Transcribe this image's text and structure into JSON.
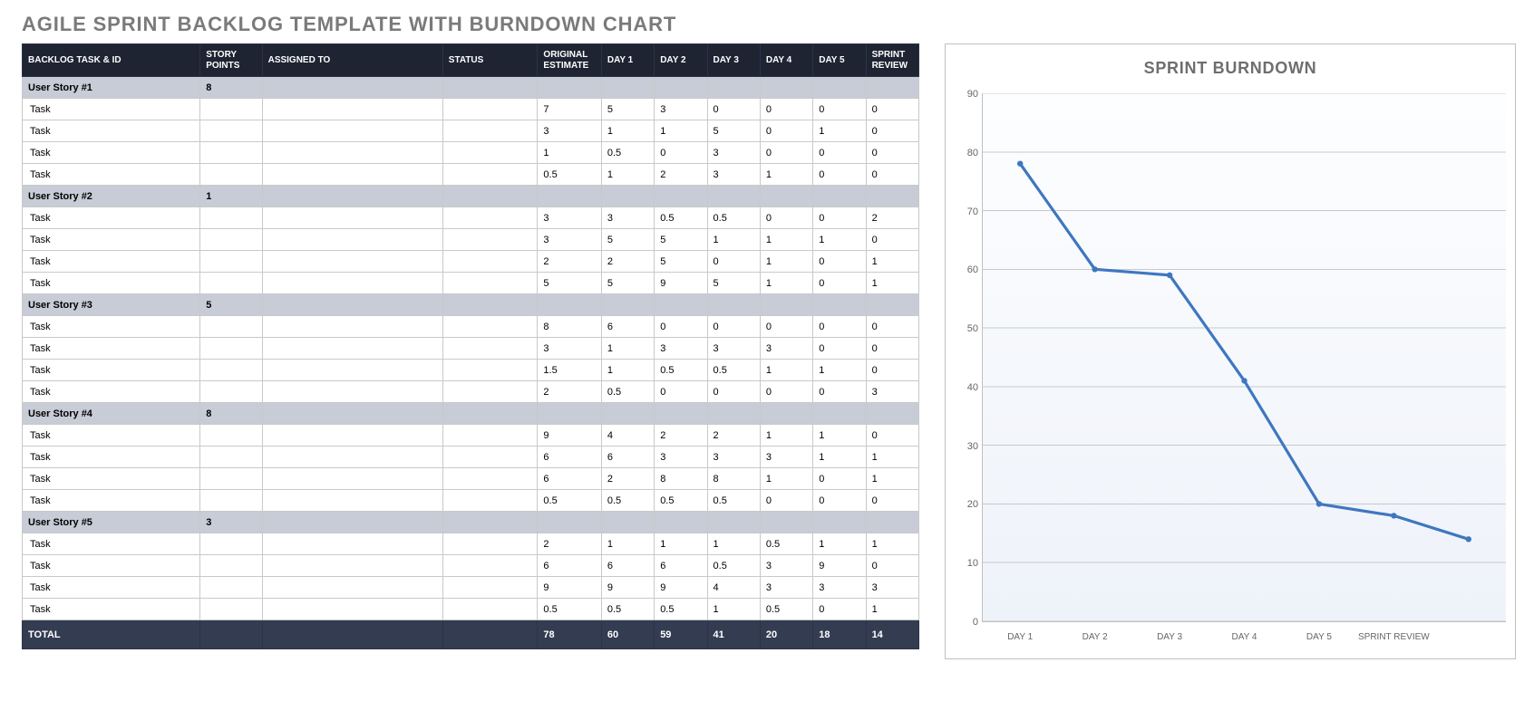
{
  "title": "AGILE SPRINT BACKLOG TEMPLATE WITH BURNDOWN CHART",
  "columns": [
    "BACKLOG TASK & ID",
    "STORY POINTS",
    "ASSIGNED TO",
    "STATUS",
    "ORIGINAL ESTIMATE",
    "DAY 1",
    "DAY 2",
    "DAY 3",
    "DAY 4",
    "DAY 5",
    "SPRINT REVIEW"
  ],
  "rows": [
    {
      "type": "story",
      "task": "User Story #1",
      "sp": "8",
      "assigned": "",
      "status": "",
      "vals": [
        "",
        "",
        "",
        "",
        "",
        "",
        ""
      ]
    },
    {
      "type": "task",
      "task": "Task",
      "sp": "",
      "assigned": "",
      "status": "",
      "vals": [
        "7",
        "5",
        "3",
        "0",
        "0",
        "0",
        "0"
      ]
    },
    {
      "type": "task",
      "task": "Task",
      "sp": "",
      "assigned": "",
      "status": "",
      "vals": [
        "3",
        "1",
        "1",
        "5",
        "0",
        "1",
        "0"
      ]
    },
    {
      "type": "task",
      "task": "Task",
      "sp": "",
      "assigned": "",
      "status": "",
      "vals": [
        "1",
        "0.5",
        "0",
        "3",
        "0",
        "0",
        "0"
      ]
    },
    {
      "type": "task",
      "task": "Task",
      "sp": "",
      "assigned": "",
      "status": "",
      "vals": [
        "0.5",
        "1",
        "2",
        "3",
        "1",
        "0",
        "0"
      ]
    },
    {
      "type": "story",
      "task": "User Story #2",
      "sp": "1",
      "assigned": "",
      "status": "",
      "vals": [
        "",
        "",
        "",
        "",
        "",
        "",
        ""
      ]
    },
    {
      "type": "task",
      "task": "Task",
      "sp": "",
      "assigned": "",
      "status": "",
      "vals": [
        "3",
        "3",
        "0.5",
        "0.5",
        "0",
        "0",
        "2"
      ]
    },
    {
      "type": "task",
      "task": "Task",
      "sp": "",
      "assigned": "",
      "status": "",
      "vals": [
        "3",
        "5",
        "5",
        "1",
        "1",
        "1",
        "0"
      ]
    },
    {
      "type": "task",
      "task": "Task",
      "sp": "",
      "assigned": "",
      "status": "",
      "vals": [
        "2",
        "2",
        "5",
        "0",
        "1",
        "0",
        "1"
      ]
    },
    {
      "type": "task",
      "task": "Task",
      "sp": "",
      "assigned": "",
      "status": "",
      "vals": [
        "5",
        "5",
        "9",
        "5",
        "1",
        "0",
        "1"
      ]
    },
    {
      "type": "story",
      "task": "User Story #3",
      "sp": "5",
      "assigned": "",
      "status": "",
      "vals": [
        "",
        "",
        "",
        "",
        "",
        "",
        ""
      ]
    },
    {
      "type": "task",
      "task": "Task",
      "sp": "",
      "assigned": "",
      "status": "",
      "vals": [
        "8",
        "6",
        "0",
        "0",
        "0",
        "0",
        "0"
      ]
    },
    {
      "type": "task",
      "task": "Task",
      "sp": "",
      "assigned": "",
      "status": "",
      "vals": [
        "3",
        "1",
        "3",
        "3",
        "3",
        "0",
        "0"
      ]
    },
    {
      "type": "task",
      "task": "Task",
      "sp": "",
      "assigned": "",
      "status": "",
      "vals": [
        "1.5",
        "1",
        "0.5",
        "0.5",
        "1",
        "1",
        "0"
      ]
    },
    {
      "type": "task",
      "task": "Task",
      "sp": "",
      "assigned": "",
      "status": "",
      "vals": [
        "2",
        "0.5",
        "0",
        "0",
        "0",
        "0",
        "3"
      ]
    },
    {
      "type": "story",
      "task": "User Story #4",
      "sp": "8",
      "assigned": "",
      "status": "",
      "vals": [
        "",
        "",
        "",
        "",
        "",
        "",
        ""
      ]
    },
    {
      "type": "task",
      "task": "Task",
      "sp": "",
      "assigned": "",
      "status": "",
      "vals": [
        "9",
        "4",
        "2",
        "2",
        "1",
        "1",
        "0"
      ]
    },
    {
      "type": "task",
      "task": "Task",
      "sp": "",
      "assigned": "",
      "status": "",
      "vals": [
        "6",
        "6",
        "3",
        "3",
        "3",
        "1",
        "1"
      ]
    },
    {
      "type": "task",
      "task": "Task",
      "sp": "",
      "assigned": "",
      "status": "",
      "vals": [
        "6",
        "2",
        "8",
        "8",
        "1",
        "0",
        "1"
      ]
    },
    {
      "type": "task",
      "task": "Task",
      "sp": "",
      "assigned": "",
      "status": "",
      "vals": [
        "0.5",
        "0.5",
        "0.5",
        "0.5",
        "0",
        "0",
        "0"
      ]
    },
    {
      "type": "story",
      "task": "User Story #5",
      "sp": "3",
      "assigned": "",
      "status": "",
      "vals": [
        "",
        "",
        "",
        "",
        "",
        "",
        ""
      ]
    },
    {
      "type": "task",
      "task": "Task",
      "sp": "",
      "assigned": "",
      "status": "",
      "vals": [
        "2",
        "1",
        "1",
        "1",
        "0.5",
        "1",
        "1"
      ]
    },
    {
      "type": "task",
      "task": "Task",
      "sp": "",
      "assigned": "",
      "status": "",
      "vals": [
        "6",
        "6",
        "6",
        "0.5",
        "3",
        "9",
        "0"
      ]
    },
    {
      "type": "task",
      "task": "Task",
      "sp": "",
      "assigned": "",
      "status": "",
      "vals": [
        "9",
        "9",
        "9",
        "4",
        "3",
        "3",
        "3"
      ]
    },
    {
      "type": "task",
      "task": "Task",
      "sp": "",
      "assigned": "",
      "status": "",
      "vals": [
        "0.5",
        "0.5",
        "0.5",
        "1",
        "0.5",
        "0",
        "1"
      ]
    }
  ],
  "totals": {
    "label": "TOTAL",
    "vals": [
      "78",
      "60",
      "59",
      "41",
      "20",
      "18",
      "14"
    ]
  },
  "chart_data": {
    "type": "line",
    "title": "SPRINT BURNDOWN",
    "categories": [
      "DAY 1",
      "DAY 2",
      "DAY 3",
      "DAY 4",
      "DAY 5",
      "SPRINT REVIEW"
    ],
    "extra_category": "",
    "values": [
      78,
      60,
      59,
      41,
      20,
      18,
      14
    ],
    "ylim": [
      0,
      90
    ],
    "yticks": [
      0,
      10,
      20,
      30,
      40,
      50,
      60,
      70,
      80,
      90
    ],
    "xlabel": "",
    "ylabel": ""
  }
}
